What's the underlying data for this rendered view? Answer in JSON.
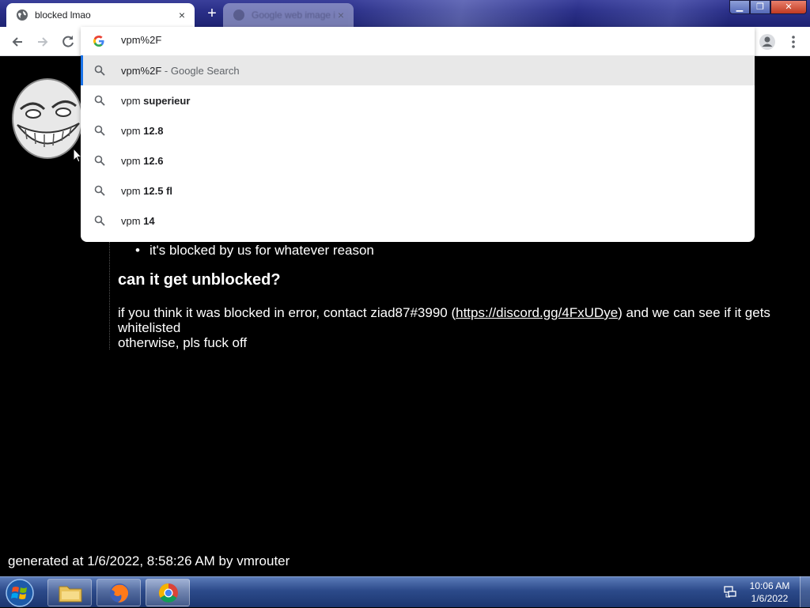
{
  "browser": {
    "active_tab_title": "blocked lmao",
    "inactive_tab_title": "Google web image illness",
    "close_glyph": "×",
    "new_tab_glyph": "+"
  },
  "window_controls": {
    "minimize": "▁",
    "maximize": "❐",
    "close": "✕"
  },
  "omnibox": {
    "input_value": "vpm%2F",
    "suggestions": [
      {
        "plain": "vpm%2F",
        "bold": "",
        "suffix": " - Google Search",
        "selected": true
      },
      {
        "plain": "vpm ",
        "bold": "superieur",
        "suffix": "",
        "selected": false
      },
      {
        "plain": "vpm ",
        "bold": "12.8",
        "suffix": "",
        "selected": false
      },
      {
        "plain": "vpm ",
        "bold": "12.6",
        "suffix": "",
        "selected": false
      },
      {
        "plain": "vpm ",
        "bold": "12.5 fl",
        "suffix": "",
        "selected": false
      },
      {
        "plain": "vpm ",
        "bold": "14",
        "suffix": "",
        "selected": false
      }
    ]
  },
  "page": {
    "bullet_glyph": "•",
    "bullet_text": "it's blocked by us for whatever reason",
    "heading": "can it get unblocked?",
    "para_before_link": "if you think it was blocked in error, contact ziad87#3990 (",
    "link_text": "https://discord.gg/4FxUDye",
    "para_after_link": ") and we can see if it gets whitelisted",
    "para_line2": "otherwise, pls fuck off",
    "footer": "generated at 1/6/2022, 8:58:26 AM by vmrouter"
  },
  "taskbar": {
    "items": [
      "windows-explorer",
      "firefox",
      "chrome"
    ],
    "clock_time": "10:06 AM",
    "clock_date": "1/6/2022"
  },
  "colors": {
    "page_background": "#000000",
    "accent_blue": "#1a73e8",
    "selected_suggestion_bg": "#e8e8e8"
  }
}
